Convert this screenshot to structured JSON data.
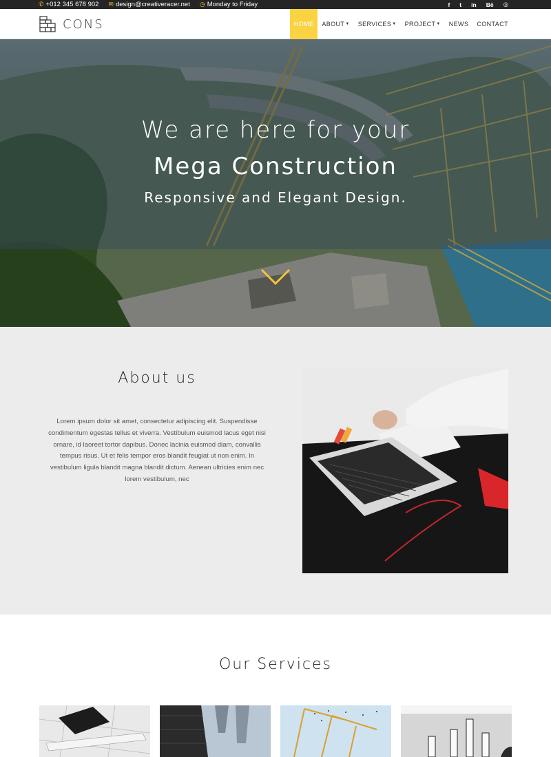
{
  "topbar": {
    "phone": "+012 345 678 902",
    "email": "design@creativeracer.net",
    "hours": "Monday to Friday",
    "social": [
      "f",
      "t",
      "in",
      "Bē",
      "◎"
    ]
  },
  "logo": {
    "name": "CONS"
  },
  "nav": [
    {
      "label": "HOME",
      "active": true
    },
    {
      "label": "ABOUT",
      "dropdown": true
    },
    {
      "label": "SERVICES",
      "dropdown": true
    },
    {
      "label": "PROJECT",
      "dropdown": true
    },
    {
      "label": "NEWS"
    },
    {
      "label": "CONTACT"
    }
  ],
  "hero": {
    "line1": "We are here for your",
    "line2": "Mega Construction",
    "line3": "Responsive and Elegant Design."
  },
  "about": {
    "title": "About us",
    "text": "Lorem ipsum dolor sit amet, consectetur adipiscing elit. Suspendisse condimentum egestas tellus et viverra. Vestibulum euismod lacus eget nisi ornare, id laoreet tortor dapibus. Donec lacinia euismod diam, convallis tempus risus. Ut et felis tempor eros blandit feugiat ut non enim. In vestibulum ligula blandit magna blandit dictum. Aenean ultricies enim nec lorem vestibulum, nec"
  },
  "services": {
    "title": "Our Services"
  },
  "colors": {
    "accent": "#f9d342",
    "topbar": "#252525",
    "about_bg": "#ececec"
  }
}
